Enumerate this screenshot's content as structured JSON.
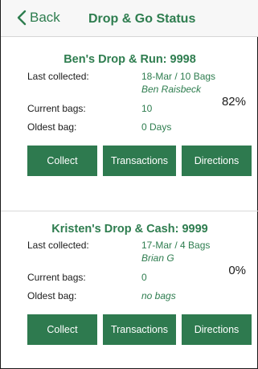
{
  "header": {
    "back_label": "Back",
    "title": "Drop & Go Status",
    "accent_color": "#2e7d4f"
  },
  "stations": [
    {
      "name": "Ben's Drop & Run: 9998",
      "last_collected_label": "Last collected:",
      "last_collected_value": "18-Mar / 10 Bags",
      "collector": "Ben Raisbeck",
      "current_bags_label": "Current bags:",
      "current_bags_value": "10",
      "oldest_bag_label": "Oldest bag:",
      "oldest_bag_value": "0 Days",
      "fill_percent": "82%",
      "buttons": {
        "collect": "Collect",
        "transactions": "Transactions",
        "directions": "Directions"
      }
    },
    {
      "name": "Kristen's Drop & Cash: 9999",
      "last_collected_label": "Last collected:",
      "last_collected_value": "17-Mar / 4 Bags",
      "collector": "Brian G",
      "current_bags_label": "Current bags:",
      "current_bags_value": "0",
      "oldest_bag_label": "Oldest bag:",
      "oldest_bag_value": "no bags",
      "fill_percent": "0%",
      "buttons": {
        "collect": "Collect",
        "transactions": "Transactions",
        "directions": "Directions"
      }
    }
  ]
}
